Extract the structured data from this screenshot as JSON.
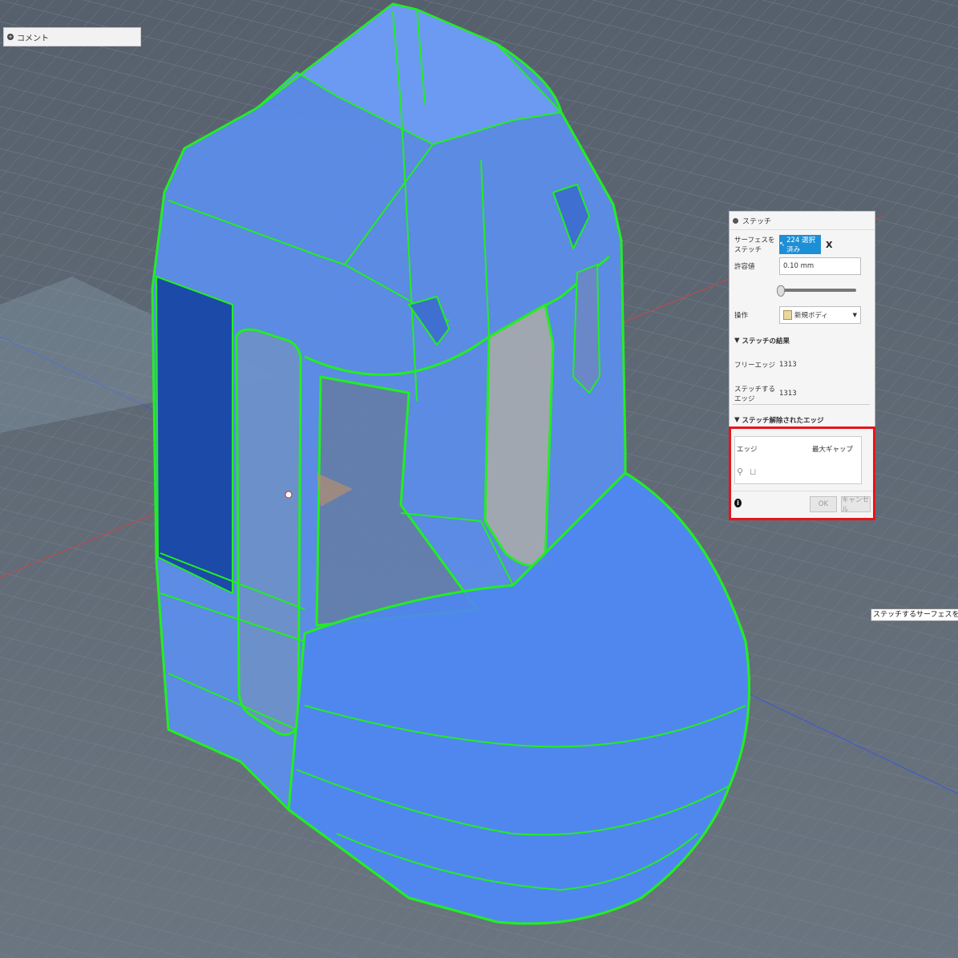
{
  "comment_panel": {
    "label": "コメント"
  },
  "stitch_dialog": {
    "title": "ステッチ",
    "surfaces_label": "サーフェスをステッチ",
    "surfaces_value": "224 選択済み",
    "clear_label": "X",
    "tolerance_label": "許容値",
    "tolerance_value": "0.10 mm",
    "tolerance_slider_fraction": 0.0,
    "operation_label": "操作",
    "operation_value": "新規ボディ",
    "results_header": "ステッチの結果",
    "free_edges_label": "フリーエッジ",
    "free_edges_value": "1313",
    "stitched_edges_label": "ステッチするエッジ",
    "stitched_edges_value": "1313",
    "unstitched_header": "ステッチ解除されたエッジ",
    "col_edge": "エッジ",
    "col_max_gap": "最大ギャップ",
    "ok_label": "OK",
    "cancel_label": "キャンセル"
  },
  "tooltip": {
    "text": "ステッチするサーフェスを選択"
  },
  "colors": {
    "highlight": "#e8141b",
    "model_face": "#5b8ff0",
    "model_edge": "#22ee22",
    "select_button": "#1d8fd6"
  }
}
